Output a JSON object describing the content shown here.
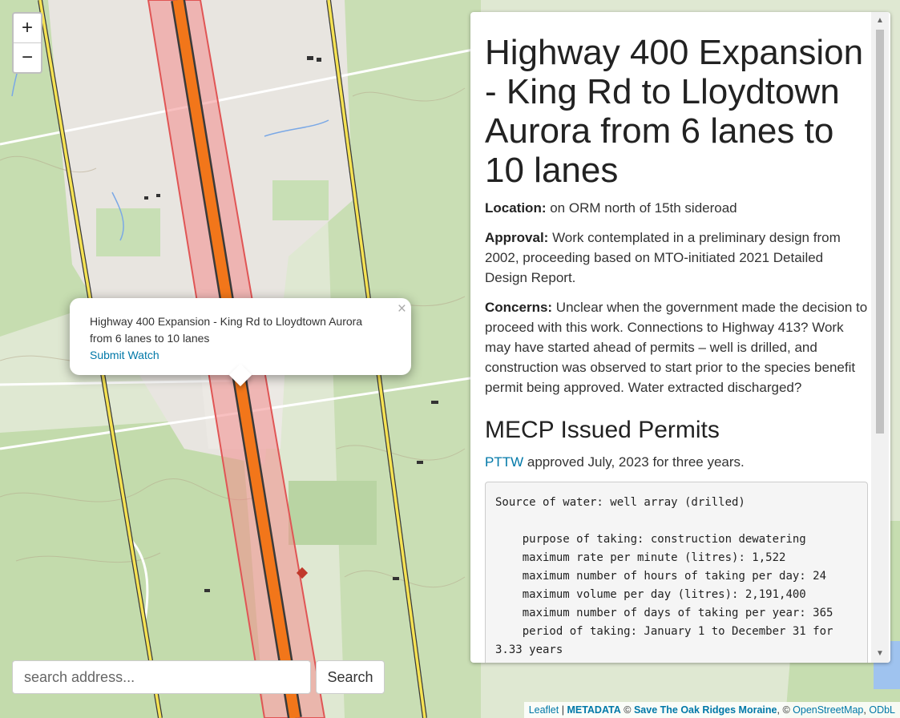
{
  "map": {
    "zoom_in_label": "+",
    "zoom_out_label": "−",
    "colors": {
      "forest": "#c3dcae",
      "land": "#e6e2dc",
      "highway": "#f2761a",
      "buffer": "#f28c8c",
      "road_yellow": "#f5e253",
      "water": "#7aa8e6"
    }
  },
  "popup": {
    "title": "Highway 400 Expansion - King Rd to Lloydtown Aurora from 6 lanes to 10 lanes",
    "link": "Submit Watch",
    "close": "×"
  },
  "search": {
    "placeholder": "search address...",
    "button": "Search"
  },
  "panel": {
    "title": "Highway 400 Expansion - King Rd to Lloydtown Aurora from 6 lanes to 10 lanes",
    "location_label": "Location:",
    "location_text": " on ORM north of 15th sideroad",
    "approval_label": "Approval:",
    "approval_text": " Work contemplated in a preliminary design from 2002, proceeding based on MTO-initiated 2021 Detailed Design Report.",
    "concerns_label": "Concerns:",
    "concerns_text": " Unclear when the government made the decision to proceed with this work. Connections to Highway 413? Work may have started ahead of permits – well is drilled, and construction was observed to start prior to the species benefit permit being approved. Water extracted discharged?",
    "permits_heading": "MECP Issued Permits",
    "pttw_link": "PTTW",
    "pttw_text": " approved July, 2023 for three years.",
    "permit_details": "Source of water: well array (drilled)\n\n    purpose of taking: construction dewatering\n    maximum rate per minute (litres): 1,522\n    maximum number of hours of taking per day: 24\n    maximum volume per day (litres): 2,191,400\n    maximum number of days of taking per year: 365\n    period of taking: January 1 to December 31 for 3.33 years"
  },
  "attribution": {
    "leaflet": "Leaflet",
    "sep1": " | ",
    "metadata": "METADATA",
    "copy1": " © ",
    "sorm": "Save The Oak Ridges Moraine",
    "copy2": ", © ",
    "osm": "OpenStreetMap",
    "comma": ", ",
    "odbl": "ODbL"
  }
}
